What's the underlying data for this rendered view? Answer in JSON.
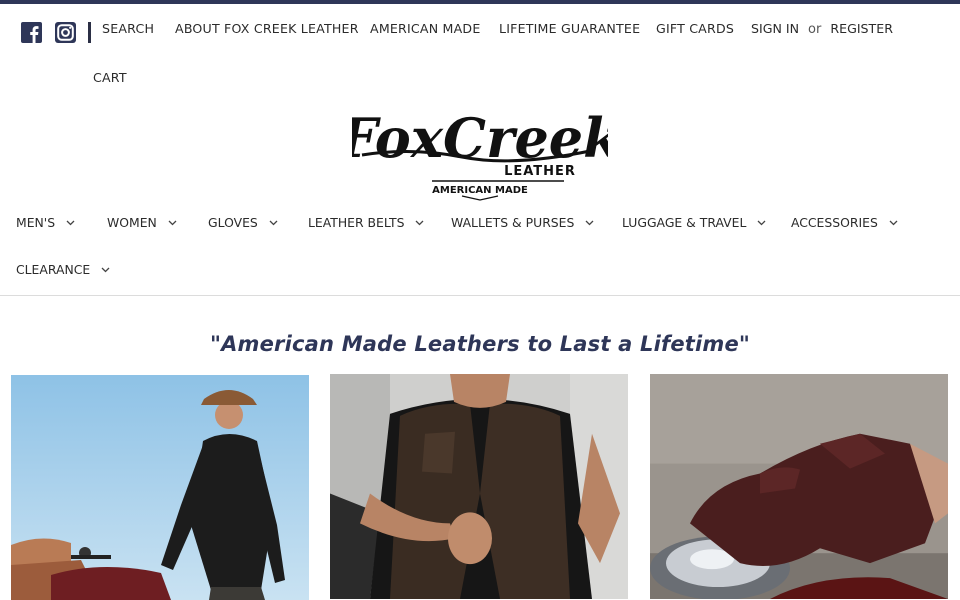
{
  "header": {
    "social": {
      "facebook_icon": "facebook-icon",
      "instagram_icon": "instagram-icon"
    },
    "links": {
      "search": "SEARCH",
      "about": "ABOUT FOX CREEK LEATHER",
      "american_made": "AMERICAN MADE",
      "lifetime_guarantee": "LIFETIME GUARANTEE",
      "gift_cards": "GIFT CARDS",
      "sign_in": "SIGN IN",
      "or": "or",
      "register": "REGISTER",
      "cart": "CART"
    },
    "logo": {
      "line1": "FoxCreek",
      "line2": "LEATHER",
      "line3": "AMERICAN MADE"
    }
  },
  "nav": {
    "items": [
      {
        "label": "MEN'S"
      },
      {
        "label": "WOMEN"
      },
      {
        "label": "GLOVES"
      },
      {
        "label": "LEATHER BELTS"
      },
      {
        "label": "WALLETS & PURSES"
      },
      {
        "label": "LUGGAGE & TRAVEL"
      },
      {
        "label": "ACCESSORIES"
      },
      {
        "label": "CLEARANCE"
      }
    ]
  },
  "main": {
    "tagline": "\"American Made Leathers to Last a Lifetime\""
  },
  "colors": {
    "brand_navy": "#2e3658",
    "text": "#2b2b2b",
    "divider": "#dcdcdc"
  }
}
